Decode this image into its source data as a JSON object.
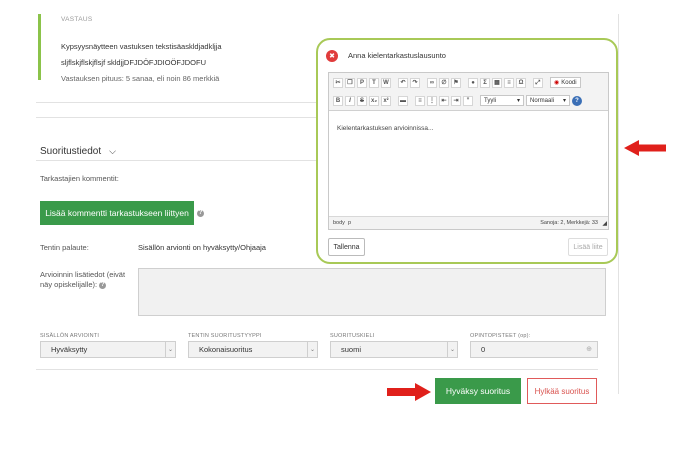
{
  "answer": {
    "label": "VASTAUS",
    "question": "Kypsyysnäytteen vastuksen tekstisäaskldjadkljja",
    "text": "sljflskjflskjflsjf skldjjDFJDÖFJDIOÖFJDOFU",
    "length": "Vastauksen pituus: 5 sanaa, eli noin 86 merkkiä"
  },
  "section": {
    "title": "Suoritustiedot",
    "chevron": "chevron-down-icon"
  },
  "comments": {
    "label": "Tarkastajien kommentit:",
    "add_button": "Lisää kommentti tarkastukseen liittyen"
  },
  "feedback": {
    "label": "Tentin palaute:",
    "value": "Sisällön arvionti on hyväksytty/Ohjaaja"
  },
  "extra_info": {
    "label_line1": "Arvioinnin lisätiedot (eivät",
    "label_line2": "näy opiskelijalle):"
  },
  "fields": [
    {
      "label": "SISÄLLÖN ARVIOINTI",
      "value": "Hyväksytty"
    },
    {
      "label": "TENTIN SUORITUSTYYPPI",
      "value": "Kokonaisuoritus"
    },
    {
      "label": "SUORITUSKIELI",
      "value": "suomi"
    },
    {
      "label": "OPINTOPISTEET (op):",
      "value": "0"
    }
  ],
  "actions": {
    "approve": "Hyväksy suoritus",
    "reject": "Hylkää suoritus"
  },
  "popup": {
    "title": "Anna kielentarkastuslausunto",
    "content": "Kielentarkastuksen arvioinnissa...",
    "style_dropdown": "Tyyli",
    "format_dropdown": "Normaali",
    "code_button": "Koodi",
    "status_path": "body  p",
    "word_count": "Sanoja: 2, Merkkejä: 33",
    "save_button": "Tallenna",
    "attach_button": "Lisää liite"
  },
  "colors": {
    "green": "#3a9a4a",
    "popup_border": "#a8c957",
    "arrow_red": "#e0201b",
    "reject_red": "#d9534f"
  }
}
